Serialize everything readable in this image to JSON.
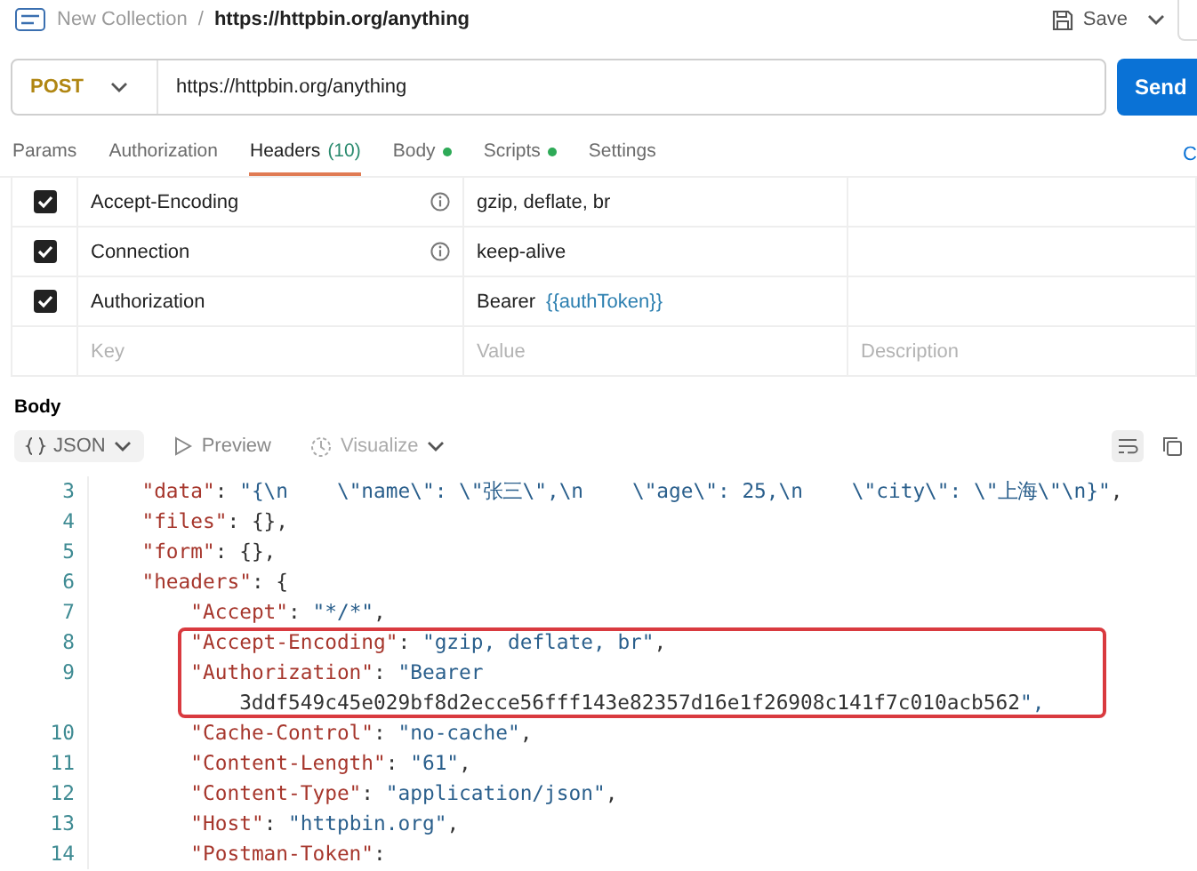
{
  "breadcrumb": {
    "collection": "New Collection",
    "separator": "/",
    "request": "https://httpbin.org/anything"
  },
  "save_button": {
    "label": "Save"
  },
  "request": {
    "method": "POST",
    "url": "https://httpbin.org/anything",
    "send_label": "Send"
  },
  "request_tabs": [
    {
      "label": "Params",
      "selected": false,
      "dot": false
    },
    {
      "label": "Authorization",
      "selected": false,
      "dot": false
    },
    {
      "label": "Headers",
      "count": "(10)",
      "selected": true,
      "dot": false
    },
    {
      "label": "Body",
      "selected": false,
      "dot": true
    },
    {
      "label": "Scripts",
      "selected": false,
      "dot": true
    },
    {
      "label": "Settings",
      "selected": false,
      "dot": false
    }
  ],
  "cookies_link": "C",
  "headers_table": {
    "rows": [
      {
        "checked": true,
        "key": "Accept-Encoding",
        "info": true,
        "value": "gzip, deflate, br"
      },
      {
        "checked": true,
        "key": "Connection",
        "info": true,
        "value": "keep-alive"
      },
      {
        "checked": true,
        "key": "Authorization",
        "info": false,
        "value": "Bearer",
        "variable": "{{authToken}}"
      }
    ],
    "placeholders": {
      "key": "Key",
      "value": "Value",
      "description": "Description"
    }
  },
  "response": {
    "tab": "Body",
    "format": "JSON",
    "preview": "Preview",
    "visualize": "Visualize",
    "lines": [
      {
        "number": "3",
        "text": "  \"data\": \"{\\n    \\\"name\\\": \\\"张三\\\",\\n    \\\"age\\\": 25,\\n    \\\"city\\\": \\\"上海\\\"\\n}\",",
        "highlighted": false
      },
      {
        "number": "4",
        "text": "  \"files\": {},",
        "highlighted": false
      },
      {
        "number": "5",
        "text": "  \"form\": {},",
        "highlighted": false
      },
      {
        "number": "6",
        "text": "  \"headers\": {",
        "highlighted": false
      },
      {
        "number": "7",
        "text": "      \"Accept\": \"*/*\",",
        "highlighted": false
      },
      {
        "number": "8",
        "text": "      \"Accept-Encoding\": \"gzip, deflate, br\",",
        "highlighted": true
      },
      {
        "number": "9",
        "text": "      \"Authorization\": \"Bearer",
        "continuation": "          3ddf549c45e029bf8d2ecce56fff143e82357d16e1f26908c141f7c010acb562\",",
        "highlighted": true
      },
      {
        "number": "10",
        "text": "      \"Cache-Control\": \"no-cache\",",
        "highlighted": false
      },
      {
        "number": "11",
        "text": "      \"Content-Length\": \"61\",",
        "highlighted": false
      },
      {
        "number": "12",
        "text": "      \"Content-Type\": \"application/json\",",
        "highlighted": false
      },
      {
        "number": "13",
        "text": "      \"Host\": \"httpbin.org\",",
        "highlighted": false
      },
      {
        "number": "14",
        "text": "      \"Postman-Token\":",
        "highlighted": false
      }
    ]
  }
}
